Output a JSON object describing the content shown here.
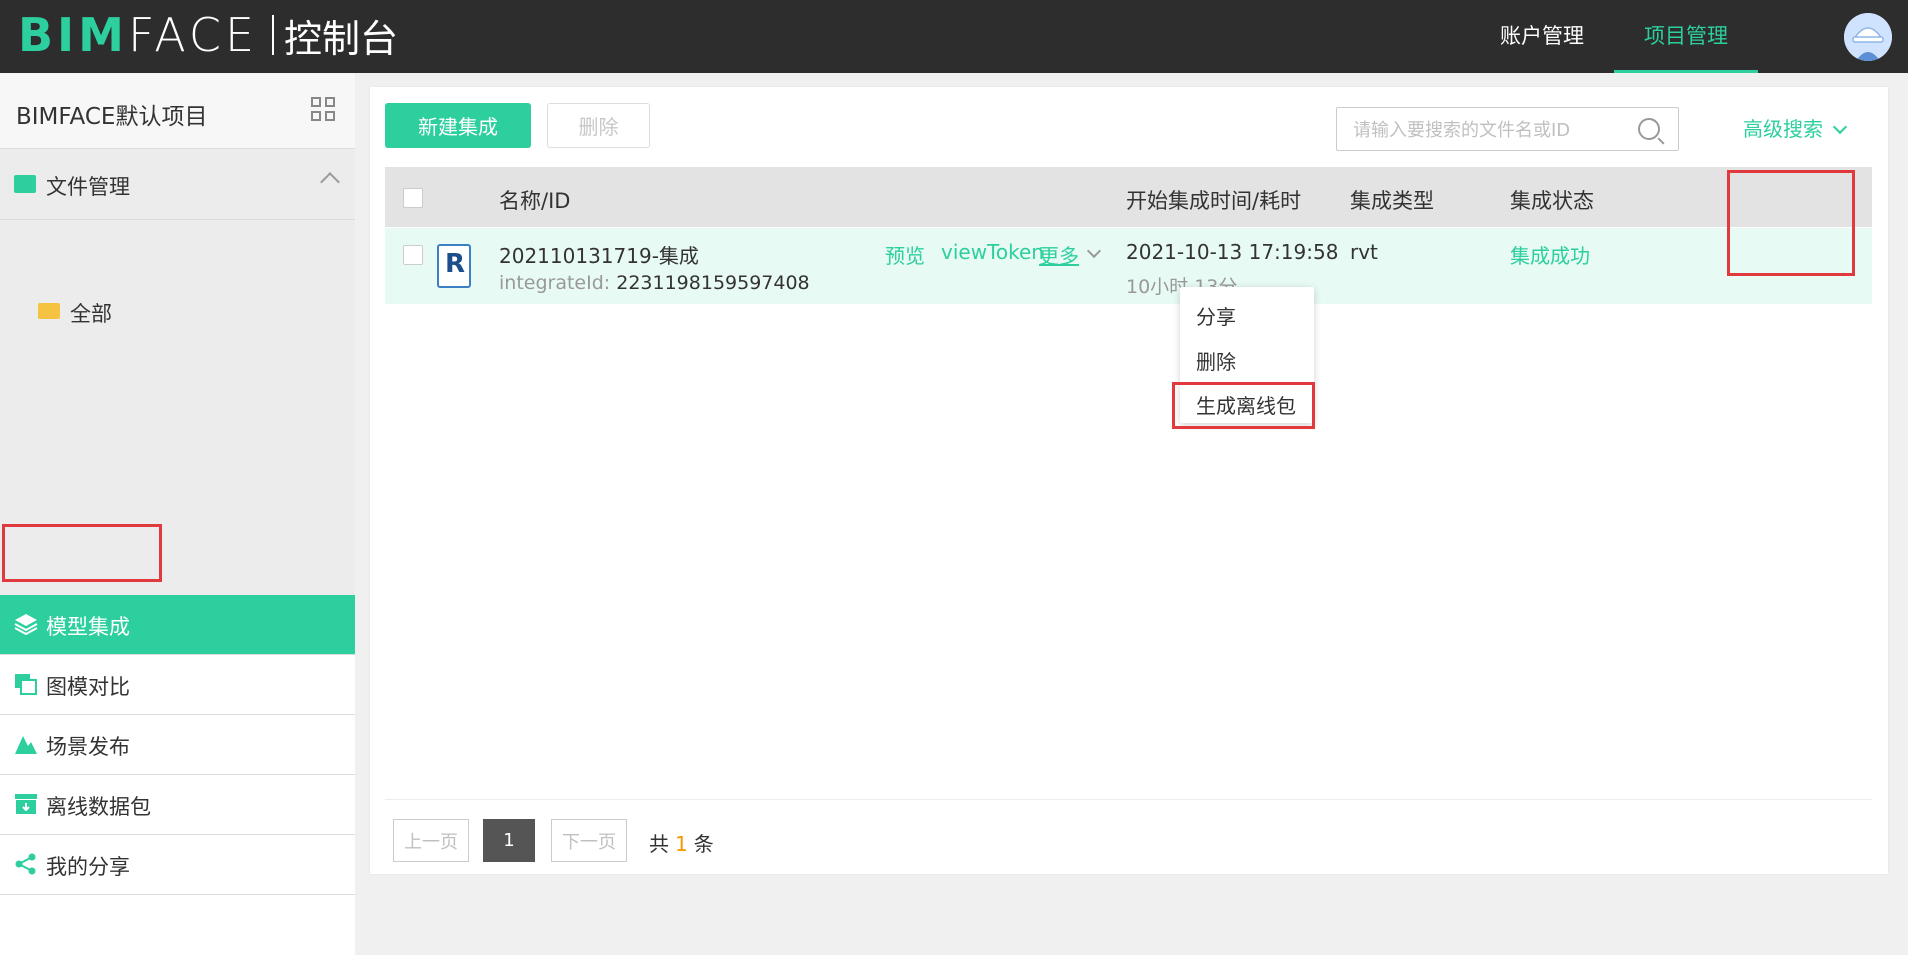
{
  "header": {
    "logo_main": "BIMFACE",
    "logo_sub": "控制台",
    "nav": [
      "账户管理",
      "项目管理"
    ]
  },
  "sidebar": {
    "project_title": "BIMFACE默认项目",
    "file_mgmt": "文件管理",
    "all": "全部",
    "items": [
      "模型集成",
      "图模对比",
      "场景发布",
      "离线数据包",
      "我的分享"
    ]
  },
  "toolbar": {
    "new_label": "新建集成",
    "delete_label": "删除",
    "search_placeholder": "请输入要搜索的文件名或ID",
    "advanced_search": "高级搜索"
  },
  "table": {
    "headers": [
      "名称/ID",
      "开始集成时间/耗时",
      "集成类型",
      "集成状态"
    ],
    "row": {
      "name": "202110131719-集成",
      "id_label": "integrateId: ",
      "id_value": "2231198159597408",
      "actions": [
        "预览",
        "viewToken",
        "更多"
      ],
      "start_time": "2021-10-13 17:19:58",
      "duration": "10小时 13分",
      "type": "rvt",
      "status": "集成成功"
    }
  },
  "more_menu": [
    "分享",
    "删除",
    "生成离线包"
  ],
  "pagination": {
    "prev": "上一页",
    "page": "1",
    "next": "下一页",
    "total_prefix": "共",
    "total_count": "1",
    "total_suffix": "条"
  },
  "colors": {
    "accent": "#2ccf9d",
    "highlight": "#e0393e",
    "topbar": "#2d2d2d"
  }
}
